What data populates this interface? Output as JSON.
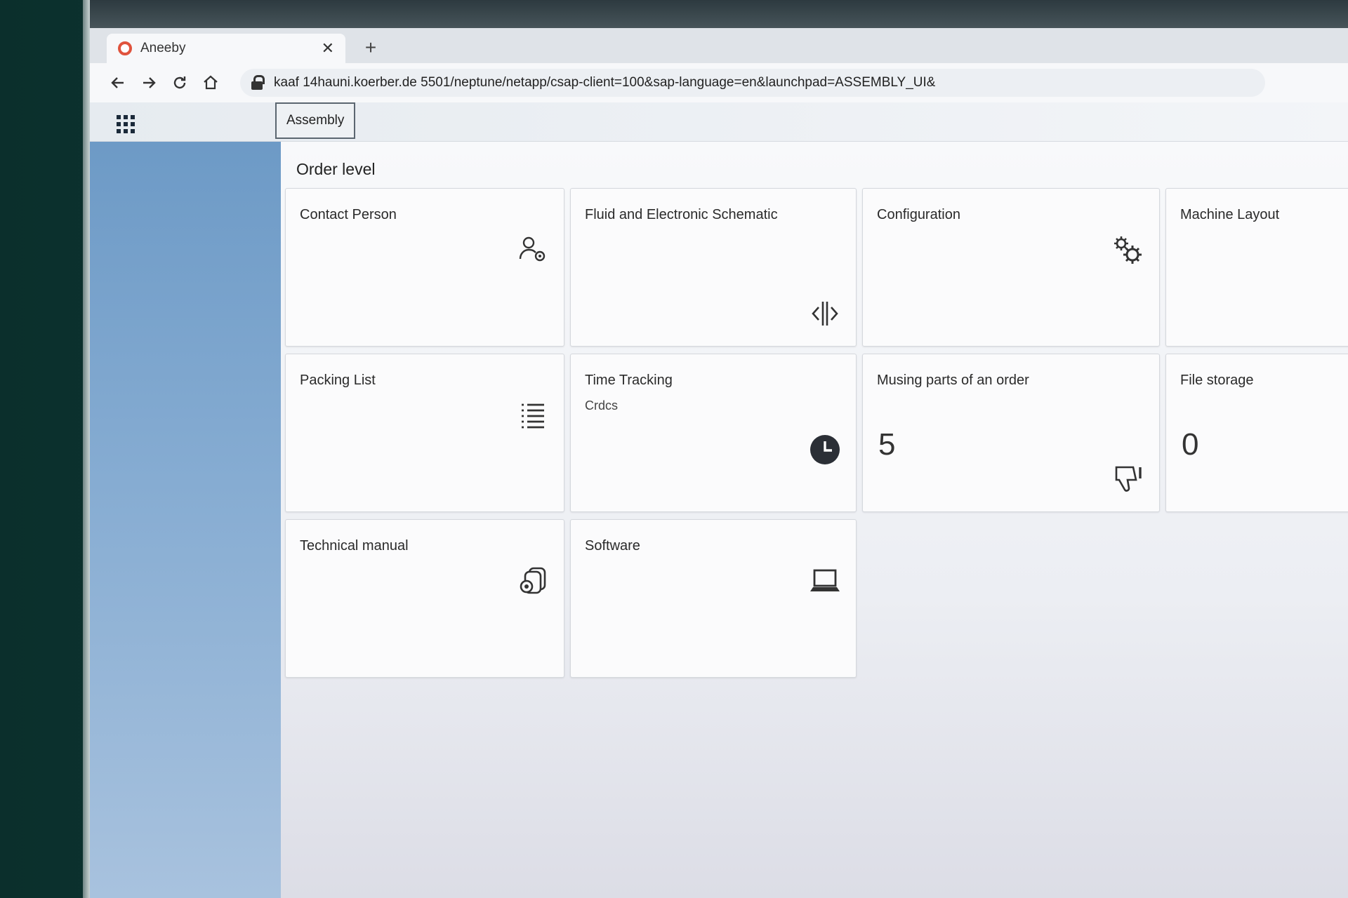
{
  "browser": {
    "tab_title": "Aneeby",
    "tab_close": "✕",
    "new_tab": "+",
    "url": "kaaf 14hauni.koerber.de 5501/neptune/netapp/csap-client=100&sap-language=en&launchpad=ASSEMBLY_UI&"
  },
  "header": {
    "space_tab": "Assembly"
  },
  "main": {
    "section_title": "Order level",
    "tiles": [
      {
        "title": "Contact Person",
        "icon": "contact-person-icon"
      },
      {
        "title": "Fluid and Electronic Schematic",
        "icon": "split-view-icon"
      },
      {
        "title": "Configuration",
        "icon": "gears-icon"
      },
      {
        "title": "Machine Layout",
        "icon": ""
      },
      {
        "title": "Packing List",
        "icon": "list-icon"
      },
      {
        "title": "Time Tracking",
        "subtitle": "Crdcs",
        "icon": "clock-icon"
      },
      {
        "title": "Musing parts of an order",
        "number": "5",
        "icon": "thumbs-down-icon"
      },
      {
        "title": "File storage",
        "number": "0",
        "icon": ""
      },
      {
        "title": "Technical manual",
        "icon": "documents-icon"
      },
      {
        "title": "Software",
        "icon": "laptop-icon"
      }
    ]
  },
  "colors": {
    "sidebar": "#7aa3cc",
    "favicon": "#e0533d",
    "tile_bg": "#fbfbfc"
  }
}
